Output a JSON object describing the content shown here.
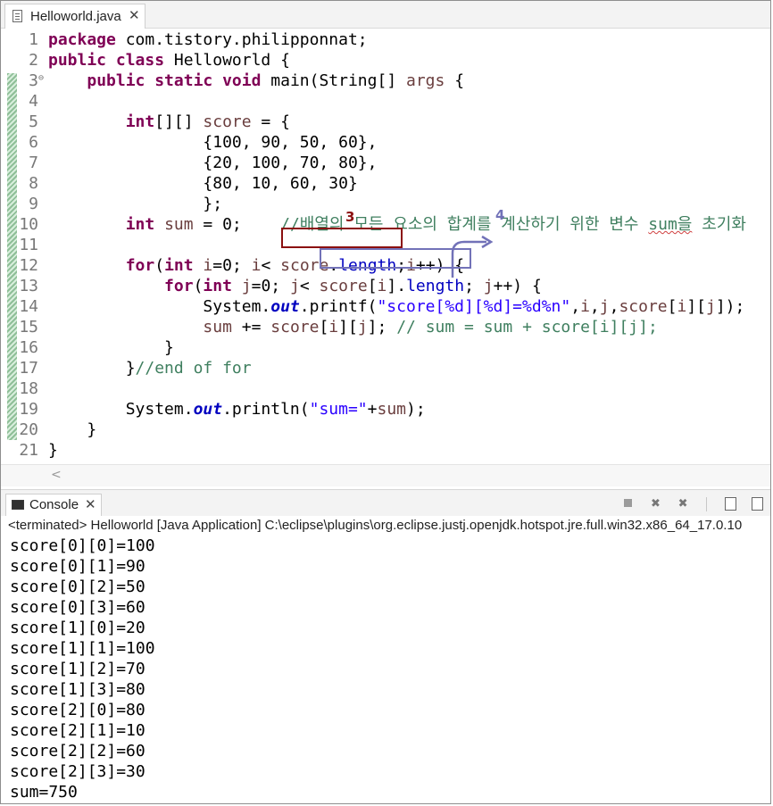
{
  "editor": {
    "tab_title": "Helloworld.java",
    "tab_close": "✕",
    "lines": [
      {
        "n": "1",
        "parts": [
          [
            "kw",
            "package"
          ],
          [
            "",
            " com.tistory.philipponnat;"
          ]
        ]
      },
      {
        "n": "2",
        "parts": [
          [
            "kw",
            "public class"
          ],
          [
            "",
            " Helloworld {"
          ]
        ]
      },
      {
        "n": "3",
        "fold": true,
        "parts": [
          [
            "",
            "    "
          ],
          [
            "kw",
            "public static void"
          ],
          [
            "",
            " main(String[] "
          ],
          [
            "var",
            "args"
          ],
          [
            "",
            " {"
          ]
        ]
      },
      {
        "n": "4",
        "parts": []
      },
      {
        "n": "5",
        "parts": [
          [
            "",
            "        "
          ],
          [
            "kw",
            "int"
          ],
          [
            "",
            "[][] "
          ],
          [
            "var",
            "score"
          ],
          [
            "",
            " = {"
          ]
        ]
      },
      {
        "n": "6",
        "parts": [
          [
            "",
            "                {100, 90, 50, 60},"
          ]
        ]
      },
      {
        "n": "7",
        "parts": [
          [
            "",
            "                {20, 100, 70, 80},"
          ]
        ]
      },
      {
        "n": "8",
        "parts": [
          [
            "",
            "                {80, 10, 60, 30}"
          ]
        ]
      },
      {
        "n": "9",
        "parts": [
          [
            "",
            "                };"
          ]
        ]
      },
      {
        "n": "10",
        "parts": [
          [
            "",
            "        "
          ],
          [
            "kw",
            "int"
          ],
          [
            "",
            " "
          ],
          [
            "var",
            "sum"
          ],
          [
            "",
            " = 0;    "
          ],
          [
            "cmt",
            "//배열의 모든 요소의 합계를 계산하기 위한 변수 "
          ],
          [
            "cmtsq",
            "sum을"
          ],
          [
            "cmt",
            " 초기화"
          ]
        ]
      },
      {
        "n": "11",
        "parts": []
      },
      {
        "n": "12",
        "parts": [
          [
            "",
            "        "
          ],
          [
            "kw",
            "for"
          ],
          [
            "",
            "("
          ],
          [
            "kw",
            "int"
          ],
          [
            "",
            " "
          ],
          [
            "var",
            "i"
          ],
          [
            "",
            "=0; "
          ],
          [
            "var",
            "i"
          ],
          [
            "",
            "< "
          ],
          [
            "var",
            "score"
          ],
          [
            "",
            "."
          ],
          [
            "fld2",
            "length"
          ],
          [
            "",
            ";"
          ],
          [
            "var",
            "i"
          ],
          [
            "",
            "++) {"
          ]
        ]
      },
      {
        "n": "13",
        "parts": [
          [
            "",
            "            "
          ],
          [
            "kw",
            "for"
          ],
          [
            "",
            "("
          ],
          [
            "kw",
            "int"
          ],
          [
            "",
            " "
          ],
          [
            "var",
            "j"
          ],
          [
            "",
            "=0; "
          ],
          [
            "var",
            "j"
          ],
          [
            "",
            "< "
          ],
          [
            "var",
            "score"
          ],
          [
            "",
            "["
          ],
          [
            "var",
            "i"
          ],
          [
            "",
            "]."
          ],
          [
            "fld2",
            "length"
          ],
          [
            "",
            "; "
          ],
          [
            "var",
            "j"
          ],
          [
            "",
            "++) {"
          ]
        ]
      },
      {
        "n": "14",
        "parts": [
          [
            "",
            "                System."
          ],
          [
            "fld",
            "out"
          ],
          [
            "",
            ".printf("
          ],
          [
            "str",
            "\"score[%d][%d]=%d%n\""
          ],
          [
            "",
            ","
          ],
          [
            "var",
            "i"
          ],
          [
            "",
            ","
          ],
          [
            "var",
            "j"
          ],
          [
            "",
            ","
          ],
          [
            "var",
            "score"
          ],
          [
            "",
            "["
          ],
          [
            "var",
            "i"
          ],
          [
            "",
            "]["
          ],
          [
            "var",
            "j"
          ],
          [
            "",
            "]);"
          ]
        ]
      },
      {
        "n": "15",
        "parts": [
          [
            "",
            "                "
          ],
          [
            "var",
            "sum"
          ],
          [
            "",
            " += "
          ],
          [
            "var",
            "score"
          ],
          [
            "",
            "["
          ],
          [
            "var",
            "i"
          ],
          [
            "",
            "]["
          ],
          [
            "var",
            "j"
          ],
          [
            "",
            "]; "
          ],
          [
            "cmt",
            "// sum = sum + score[i][j];"
          ]
        ]
      },
      {
        "n": "16",
        "parts": [
          [
            "",
            "            }"
          ]
        ]
      },
      {
        "n": "17",
        "parts": [
          [
            "",
            "        }"
          ],
          [
            "cmt",
            "//end of for"
          ]
        ]
      },
      {
        "n": "18",
        "parts": []
      },
      {
        "n": "19",
        "parts": [
          [
            "",
            "        System."
          ],
          [
            "fld",
            "out"
          ],
          [
            "",
            ".println("
          ],
          [
            "str",
            "\"sum=\""
          ],
          [
            "",
            "+"
          ],
          [
            "var",
            "sum"
          ],
          [
            "",
            ");"
          ]
        ]
      },
      {
        "n": "20",
        "parts": [
          [
            "",
            "    }"
          ]
        ]
      },
      {
        "n": "21",
        "parts": [
          [
            "",
            "}"
          ]
        ]
      }
    ],
    "annotations": {
      "label_red": "3",
      "label_blue": "4",
      "color_red": "#8b1010",
      "color_blue": "#7272b8"
    },
    "scroll_left": "<"
  },
  "console": {
    "tab_title": "Console",
    "tab_close": "✕",
    "toolbar_icons": [
      "terminate-icon",
      "remove-launch-icon",
      "remove-all-icon",
      "scroll-lock-icon",
      "pin-icon"
    ],
    "status": "<terminated> Helloworld [Java Application] C:\\eclipse\\plugins\\org.eclipse.justj.openjdk.hotspot.jre.full.win32.x86_64_17.0.10",
    "output": [
      "score[0][0]=100",
      "score[0][1]=90",
      "score[0][2]=50",
      "score[0][3]=60",
      "score[1][0]=20",
      "score[1][1]=100",
      "score[1][2]=70",
      "score[1][3]=80",
      "score[2][0]=80",
      "score[2][1]=10",
      "score[2][2]=60",
      "score[2][3]=30",
      "sum=750"
    ]
  }
}
